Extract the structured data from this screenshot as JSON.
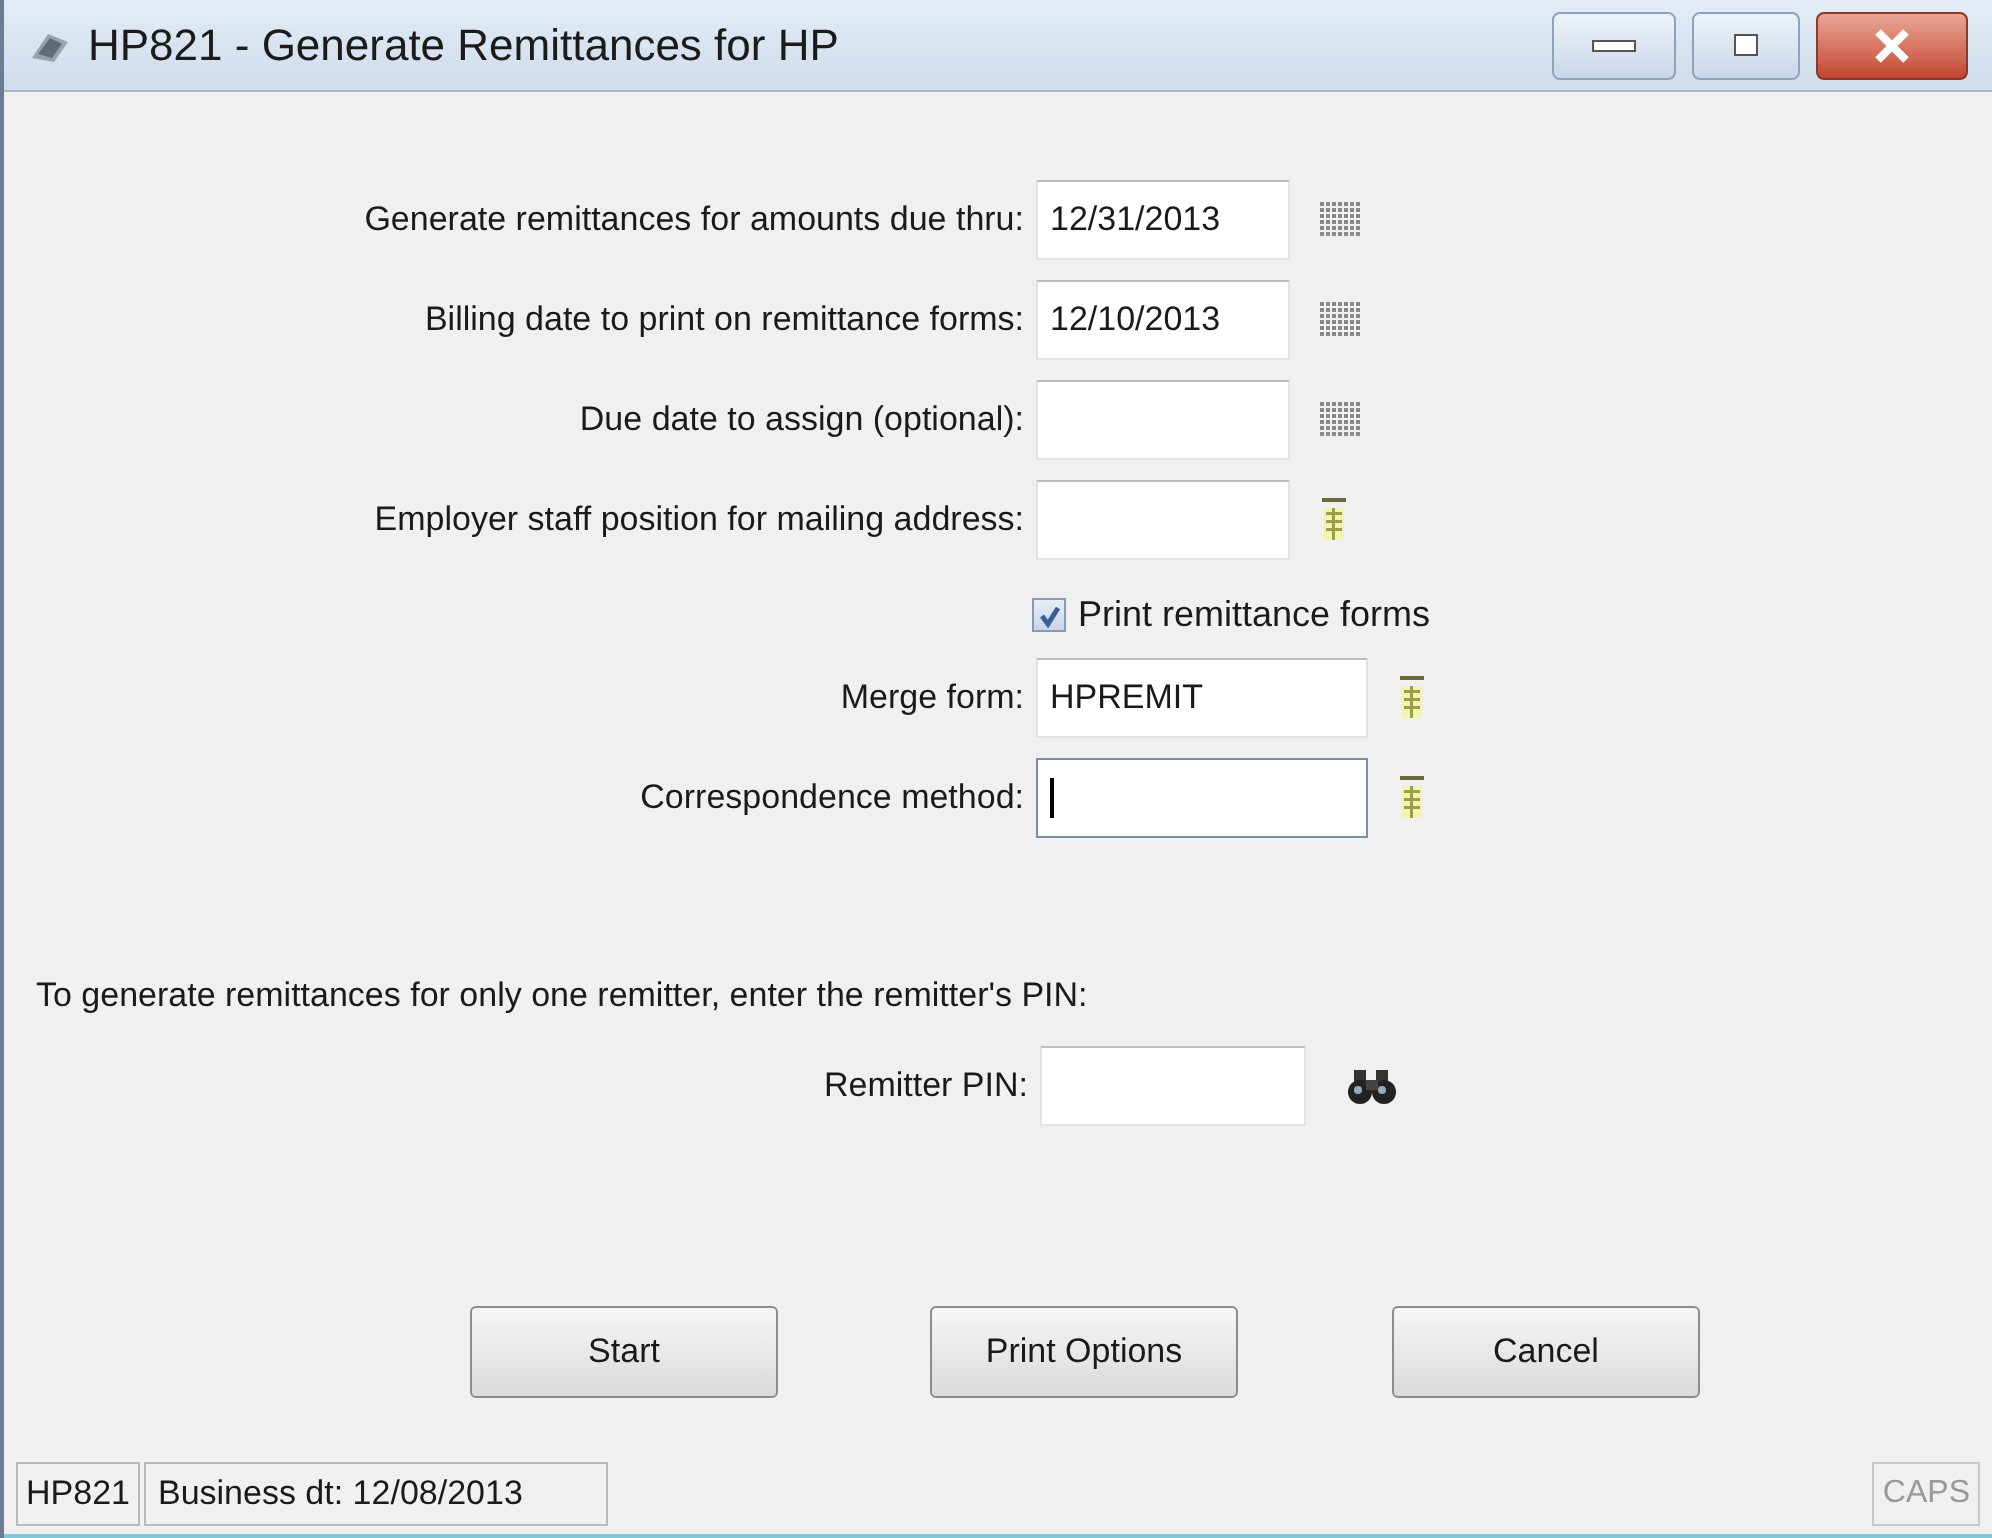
{
  "window": {
    "title": "HP821 - Generate Remittances for HP"
  },
  "fields": [
    {
      "label": "Generate remittances for amounts due thru:",
      "value": "12/31/2013",
      "kind": "date"
    },
    {
      "label": "Billing date to print on remittance forms:",
      "value": "12/10/2013",
      "kind": "date"
    },
    {
      "label": "Due date to assign (optional):",
      "kind": "date"
    },
    {
      "label": "Employer staff position for mailing address:",
      "kind": "lookup"
    }
  ],
  "checkbox": {
    "label": "Print remittance forms",
    "checked": true
  },
  "form_fields": [
    {
      "label": "Merge form:",
      "value": "HPREMIT",
      "focused": false
    },
    {
      "label": "Correspondence method:",
      "focused": true
    }
  ],
  "instruction": "To generate remittances for only one remitter, enter the remitter's PIN:",
  "remitter": {
    "label": "Remitter PIN:"
  },
  "buttons": [
    "Start",
    "Print Options",
    "Cancel"
  ],
  "status_bar": {
    "code": "HP821",
    "business_date": "Business dt: 12/08/2013",
    "caps": "CAPS"
  }
}
